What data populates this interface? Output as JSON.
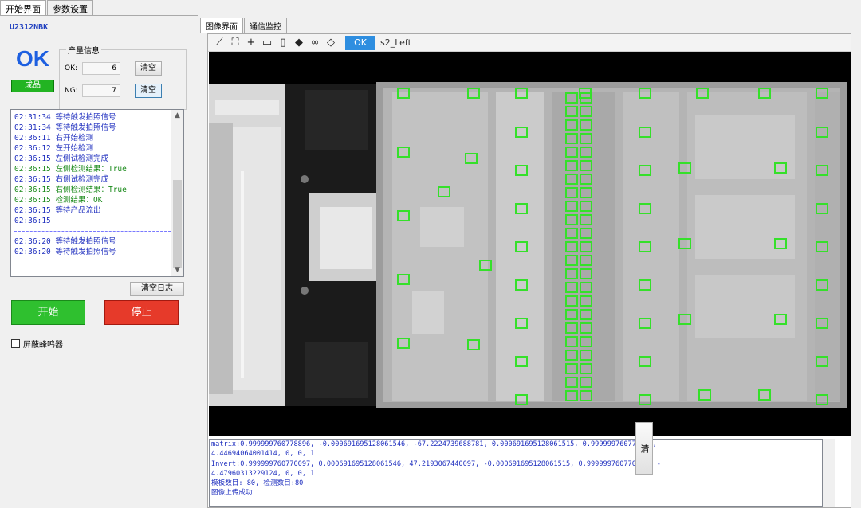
{
  "top_tabs": [
    "开始界面",
    "参数设置"
  ],
  "device_id": "U2312NBK",
  "status": {
    "big_result": "OK",
    "result_badge": "成品"
  },
  "counts": {
    "legend": "产量信息",
    "ok_label": "OK:",
    "ok_value": "6",
    "ng_label": "NG:",
    "ng_value": "7",
    "clear_label": "清空"
  },
  "log": [
    {
      "time": "02:31:34",
      "text": "等待触发拍照信号",
      "color": "blue"
    },
    {
      "time": "02:31:34",
      "text": "等待触发拍照信号",
      "color": "blue"
    },
    {
      "time": "02:36:11",
      "text": "右开始检测",
      "color": "blue"
    },
    {
      "time": "02:36:12",
      "text": "左开始检测",
      "color": "blue"
    },
    {
      "time": "02:36:15",
      "text": "左侧试检测完成",
      "color": "blue"
    },
    {
      "time": "02:36:15",
      "text": "左侧检测结果：True",
      "color": "green"
    },
    {
      "time": "02:36:15",
      "text": "右侧试检测完成",
      "color": "blue"
    },
    {
      "time": "02:36:15",
      "text": "右侧检测结果：True",
      "color": "green"
    },
    {
      "time": "02:36:15",
      "text": "检测结果：OK",
      "color": "green"
    },
    {
      "time": "02:36:15",
      "text": "等待产品流出",
      "color": "blue"
    },
    {
      "time": "02:36:15",
      "text": "",
      "color": "blue"
    },
    {
      "time": "",
      "text": "",
      "color": "sep"
    },
    {
      "time": "02:36:20",
      "text": "等待触发拍照信号",
      "color": "blue"
    },
    {
      "time": "02:36:20",
      "text": "等待触发拍照信号",
      "color": "blue"
    }
  ],
  "buttons": {
    "clear_log": "清空日志",
    "start": "开始",
    "stop": "停止",
    "mute_buzzer": "屏蔽蜂鸣器",
    "side_clear": "清"
  },
  "inner_tabs": [
    "图像界面",
    "通信监控"
  ],
  "toolbar": {
    "tools": [
      "line-tool-icon",
      "fit-icon",
      "crosshair-icon",
      "save-image-icon",
      "trash-icon",
      "eraser-icon",
      "link-icon",
      "tag-icon"
    ],
    "result_chip": "OK",
    "camera_name": "s2_Left"
  },
  "output": [
    "matrix:0.999999760778896, -0.000691695128061546, -67.2224739688781, 0.000691695128061515, 0.999999760778896,",
    "4.44694064001414, 0, 0, 1",
    "Invert:0.999999760770097, 0.000691695128061546, 47.2193067440097, -0.000691695128061515, 0.999999760770097, -",
    "4.47960313229124, 0, 0, 1",
    "模板数目: 80, 检测数目:80",
    "图像上传成功"
  ],
  "colors": {
    "accent_blue": "#1d5fe0",
    "log_blue": "#1f2fbf",
    "log_green": "#1a8a1a",
    "start_green": "#2fc02f",
    "stop_red": "#e63a2a",
    "detect_box": "#35e02a"
  }
}
